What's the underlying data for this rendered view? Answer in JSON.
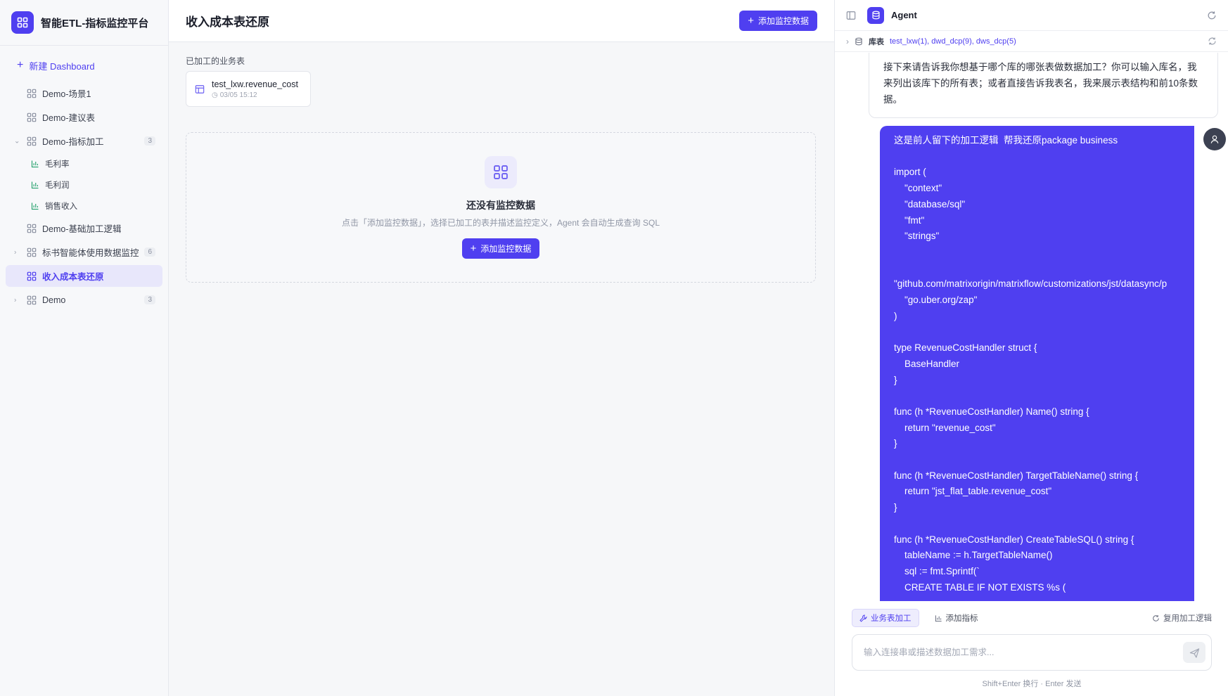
{
  "app": {
    "title": "智能ETL-指标监控平台"
  },
  "sidebar": {
    "new_dashboard": "新建 Dashboard",
    "items": [
      {
        "label": "Demo-场景1"
      },
      {
        "label": "Demo-建议表"
      },
      {
        "label": "Demo-指标加工",
        "count": "3",
        "expanded": true
      },
      {
        "label": "毛利率"
      },
      {
        "label": "毛利润"
      },
      {
        "label": "销售收入"
      },
      {
        "label": "Demo-基础加工逻辑"
      },
      {
        "label": "标书智能体使用数据监控",
        "count": "6",
        "expanded": false
      },
      {
        "label": "收入成本表还原",
        "active": true
      },
      {
        "label": "Demo",
        "count": "3",
        "expanded": false
      }
    ]
  },
  "main": {
    "title": "收入成本表还原",
    "add_button": "添加监控数据",
    "processed_label": "已加工的业务表",
    "table_card": {
      "name": "test_lxw.revenue_cost",
      "date": "03/05 15:12"
    },
    "empty": {
      "title": "还没有监控数据",
      "desc": "点击「添加监控数据」，选择已加工的表并描述监控定义，Agent 会自动生成查询 SQL",
      "button": "添加监控数据"
    }
  },
  "agent": {
    "title": "Agent",
    "db_label": "库表",
    "db_list": "test_lxw(1), dwd_dcp(9), dws_dcp(5)",
    "bot_message": "接下来请告诉我你想基于哪个库的哪张表做数据加工？你可以输入库名，我来列出该库下的所有表；或者直接告诉我表名，我来展示表结构和前10条数据。",
    "user_message": "这是前人留下的加工逻辑  帮我还原package business\n\nimport (\n    \"context\"\n    \"database/sql\"\n    \"fmt\"\n    \"strings\"\n\n\n\"github.com/matrixorigin/matrixflow/customizations/jst/datasync/p\n    \"go.uber.org/zap\"\n)\n\ntype RevenueCostHandler struct {\n    BaseHandler\n}\n\nfunc (h *RevenueCostHandler) Name() string {\n    return \"revenue_cost\"\n}\n\nfunc (h *RevenueCostHandler) TargetTableName() string {\n    return \"jst_flat_table.revenue_cost\"\n}\n\nfunc (h *RevenueCostHandler) CreateTableSQL() string {\n    tableName := h.TargetTableName()\n    sql := fmt.Sprintf(`\n    CREATE TABLE IF NOT EXISTS %s (",
    "modes": [
      "业务表加工",
      "添加指标"
    ],
    "reuse": "复用加工逻辑",
    "input_placeholder": "输入连接串或描述数据加工需求...",
    "hint": "Shift+Enter 换行 · Enter 发送"
  },
  "colors": {
    "accent": "#4f3ff0"
  }
}
